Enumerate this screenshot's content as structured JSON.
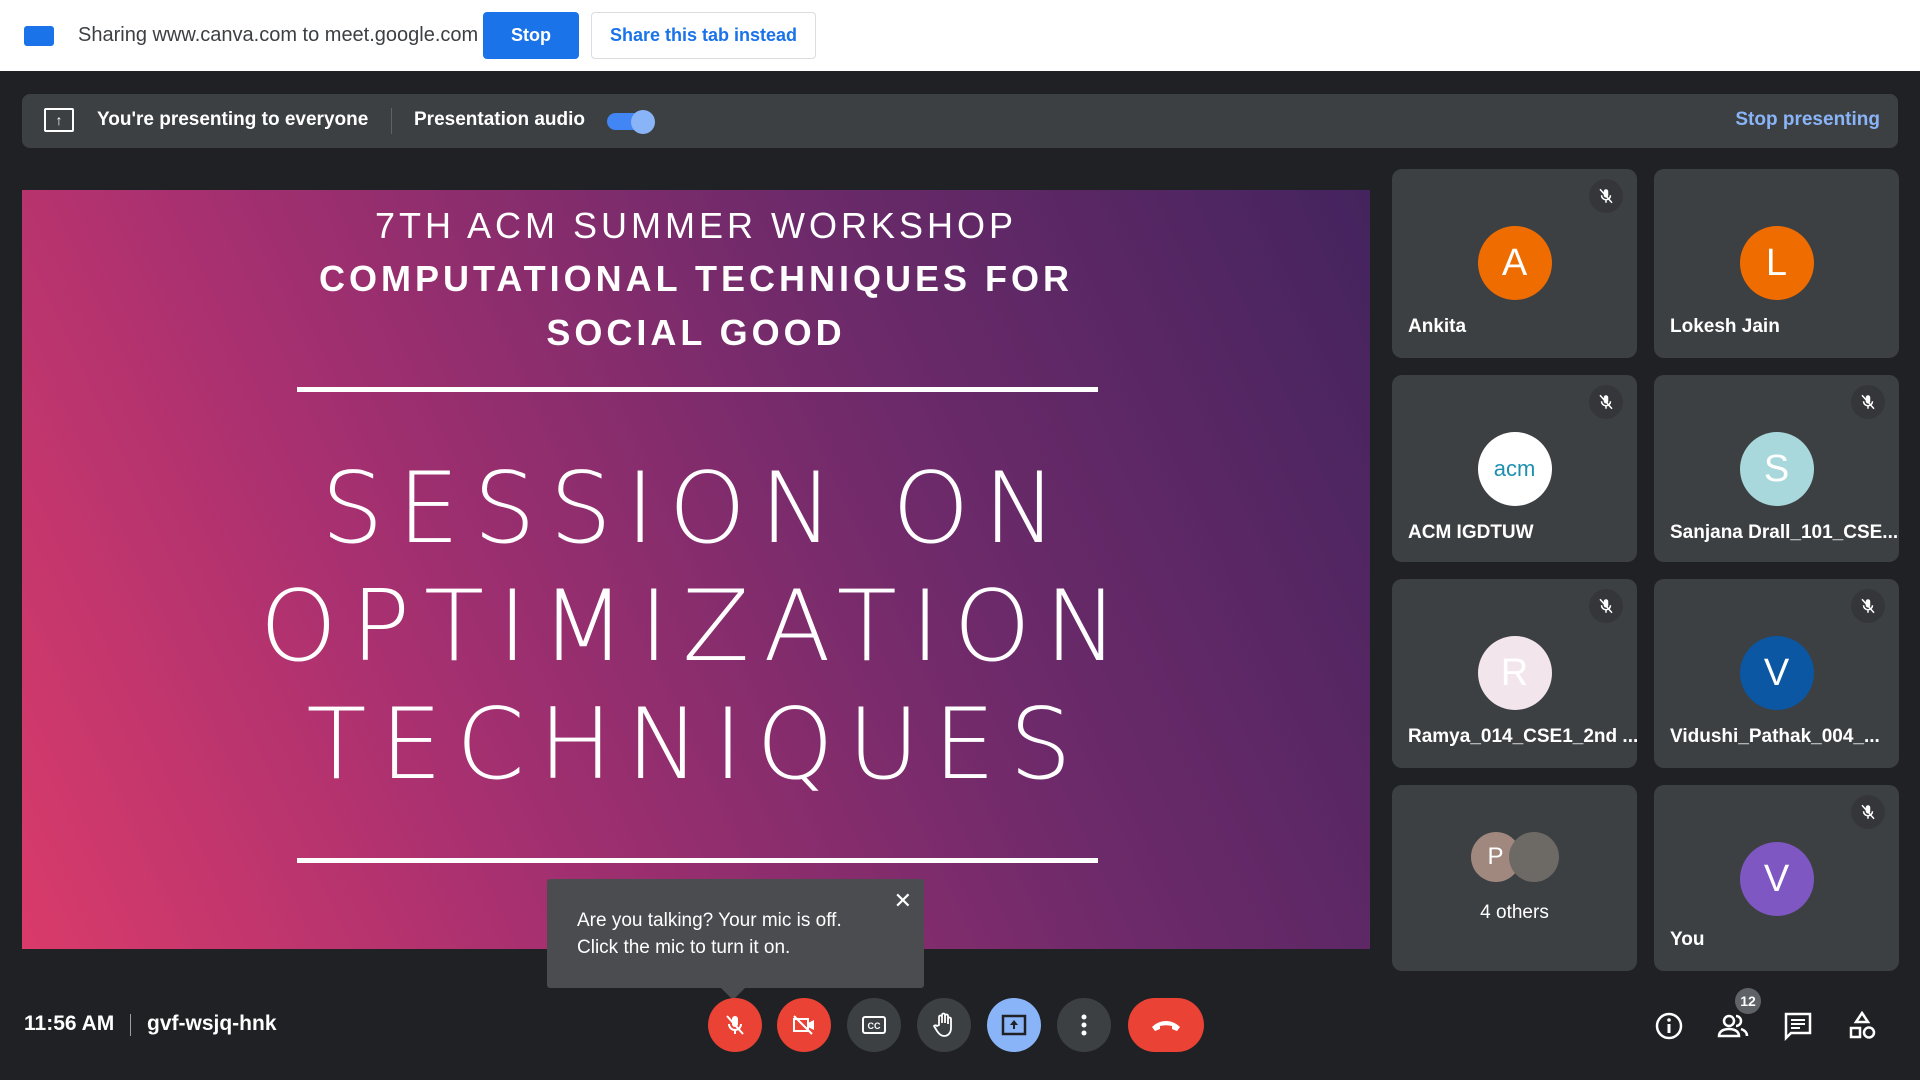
{
  "share_bar": {
    "text": "Sharing www.canva.com to meet.google.com",
    "stop_label": "Stop",
    "share_tab_label": "Share this tab instead"
  },
  "presenting_bar": {
    "status": "You're presenting to everyone",
    "audio_label": "Presentation audio",
    "audio_on": true,
    "stop_label": "Stop presenting"
  },
  "slide": {
    "line1": "7TH ACM SUMMER WORKSHOP",
    "line2": "COMPUTATIONAL TECHNIQUES FOR",
    "line3": "SOCIAL GOOD",
    "title1": "SESSION ON",
    "title2": "OPTIMIZATION",
    "title3": "TECHNIQUES"
  },
  "participants": [
    {
      "name": "Ankita",
      "initial": "A",
      "color": "#ef6c00",
      "muted": true
    },
    {
      "name": "Lokesh Jain",
      "initial": "L",
      "color": "#ef6c00",
      "muted": false
    },
    {
      "name": "ACM IGDTUW",
      "initial": "acm",
      "color": "#ffffff",
      "muted": true
    },
    {
      "name": "Sanjana Drall_101_CSE...",
      "initial": "S",
      "color": "#a8d8dc",
      "muted": true
    },
    {
      "name": "Ramya_014_CSE1_2nd ...",
      "initial": "R",
      "color": "#f3e5ec",
      "muted": true
    },
    {
      "name": "Vidushi_Pathak_004_...",
      "initial": "V",
      "color": "#0b57a4",
      "muted": true
    },
    {
      "name": "4 others",
      "initial": "P",
      "color": "#a1887f",
      "muted": false
    },
    {
      "name": "You",
      "initial": "V",
      "color": "#7e57c2",
      "muted": true
    }
  ],
  "tooltip": {
    "line1": "Are you talking? Your mic is off.",
    "line2": "Click the mic to turn it on.",
    "close": "✕"
  },
  "footer": {
    "time": "11:56 AM",
    "meeting_code": "gvf-wsjq-hnk",
    "people_count": "12"
  },
  "colors": {
    "accent": "#1a73e8",
    "danger": "#ea4335",
    "link": "#8ab4f8"
  }
}
